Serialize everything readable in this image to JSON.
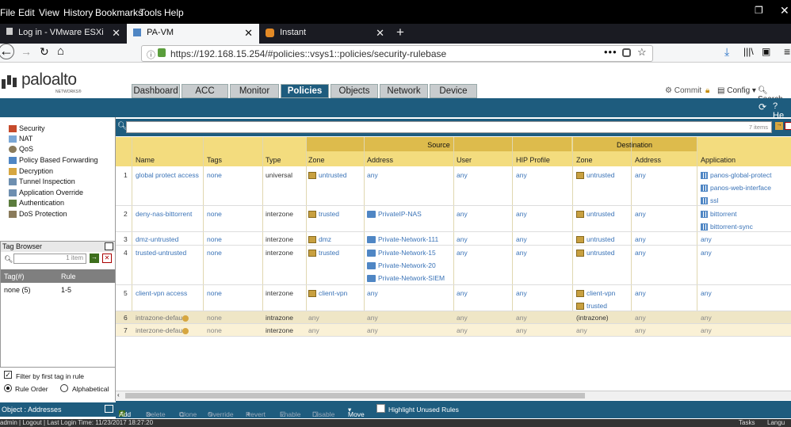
{
  "browser": {
    "menu": [
      "File",
      "Edit",
      "View",
      "History",
      "Bookmarks",
      "Tools",
      "Help"
    ],
    "tabs": [
      {
        "label": "Log in - VMware ESXi"
      },
      {
        "label": "PA-VM"
      },
      {
        "label": "Instant"
      }
    ],
    "url": "https://192.168.15.254/#policies::vsys1::policies/security-rulebase"
  },
  "header": {
    "logo": "paloalto",
    "logo_sub": "NETWORKS®",
    "tabs": [
      "Dashboard",
      "ACC",
      "Monitor",
      "Policies",
      "Objects",
      "Network",
      "Device"
    ],
    "active_tab": "Policies",
    "commit": "Commit",
    "config": "Config",
    "search": "Search",
    "help": "He"
  },
  "leftnav": {
    "items": [
      "Security",
      "NAT",
      "QoS",
      "Policy Based Forwarding",
      "Decryption",
      "Tunnel Inspection",
      "Application Override",
      "Authentication",
      "DoS Protection"
    ]
  },
  "tag_browser": {
    "title": "Tag Browser",
    "search_count": "1 item",
    "col1": "Tag(#)",
    "col2": "Rule",
    "rows": [
      {
        "tag": "none (5)",
        "rule": "1-5"
      }
    ],
    "filter_label": "Filter by first tag in rule",
    "rule_order": "Rule Order",
    "alphabetical": "Alphabetical"
  },
  "object_panel": "Object : Addresses",
  "rules_table": {
    "count": "7 items",
    "group_source": "Source",
    "group_destination": "Destination",
    "headers": [
      "Name",
      "Tags",
      "Type",
      "Zone",
      "Address",
      "User",
      "HIP Profile",
      "Zone",
      "Address",
      "Application"
    ],
    "rows": [
      {
        "num": "1",
        "name": "global protect access",
        "tags": "none",
        "type": "universal",
        "src_zone": [
          "untrusted"
        ],
        "src_addr": [
          "any"
        ],
        "user": "any",
        "hip": "any",
        "dst_zone": [
          "untrusted"
        ],
        "dst_addr": "any",
        "app": [
          "panos-global-protect",
          "panos-web-interface",
          "ssl"
        ]
      },
      {
        "num": "2",
        "name": "deny-nas-bittorrent",
        "tags": "none",
        "type": "interzone",
        "src_zone": [
          "trusted"
        ],
        "src_addr": [
          "PrivateIP-NAS"
        ],
        "user": "any",
        "hip": "any",
        "dst_zone": [
          "untrusted"
        ],
        "dst_addr": "any",
        "app": [
          "bittorrent",
          "bittorrent-sync"
        ]
      },
      {
        "num": "3",
        "name": "dmz-untrusted",
        "tags": "none",
        "type": "interzone",
        "src_zone": [
          "dmz"
        ],
        "src_addr": [
          "Private-Network-111"
        ],
        "user": "any",
        "hip": "any",
        "dst_zone": [
          "untrusted"
        ],
        "dst_addr": "any",
        "app": [
          "any"
        ]
      },
      {
        "num": "4",
        "name": "trusted-untrusted",
        "tags": "none",
        "type": "interzone",
        "src_zone": [
          "trusted"
        ],
        "src_addr": [
          "Private-Network-15",
          "Private-Network-20",
          "Private-Network-SIEM"
        ],
        "user": "any",
        "hip": "any",
        "dst_zone": [
          "untrusted"
        ],
        "dst_addr": "any",
        "app": [
          "any"
        ]
      },
      {
        "num": "5",
        "name": "client-vpn access",
        "tags": "none",
        "type": "interzone",
        "src_zone": [
          "client-vpn"
        ],
        "src_addr": [
          "any"
        ],
        "user": "any",
        "hip": "any",
        "dst_zone": [
          "client-vpn",
          "trusted"
        ],
        "dst_addr": "any",
        "app": [
          "any"
        ]
      },
      {
        "num": "6",
        "name": "intrazone-defau",
        "tags": "none",
        "type": "intrazone",
        "src_zone": [
          "any"
        ],
        "src_addr": [
          "any"
        ],
        "user": "any",
        "hip": "any",
        "dst_zone": [
          "(intrazone)"
        ],
        "dst_addr": "any",
        "app": [
          "any"
        ]
      },
      {
        "num": "7",
        "name": "interzone-defau",
        "tags": "none",
        "type": "interzone",
        "src_zone": [
          "any"
        ],
        "src_addr": [
          "any"
        ],
        "user": "any",
        "hip": "any",
        "dst_zone": [
          "any"
        ],
        "dst_addr": "any",
        "app": [
          "any"
        ]
      }
    ]
  },
  "bottom_actions": [
    "Add",
    "Delete",
    "Clone",
    "Override",
    "Revert",
    "Enable",
    "Disable",
    "Move",
    "Highlight Unused Rules"
  ],
  "status": "admin | Logout | Last Login Time: 11/23/2017 18:27:20",
  "status_right": [
    "Tasks",
    "Langu"
  ]
}
